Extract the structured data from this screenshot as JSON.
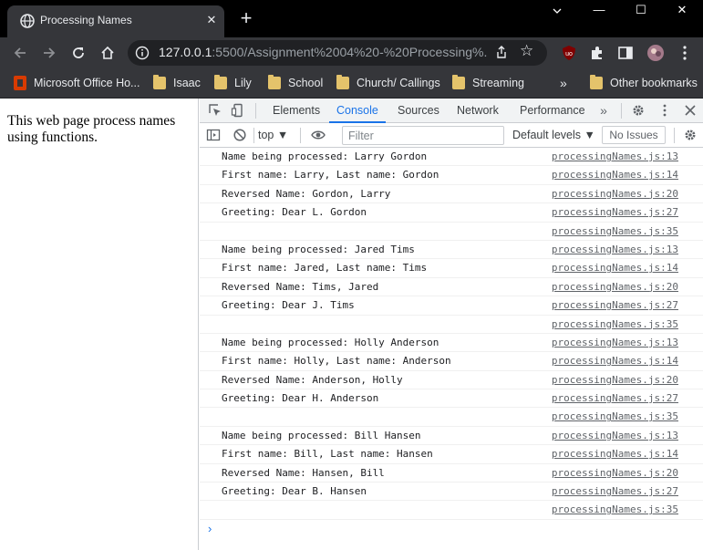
{
  "browser": {
    "tab_title": "Processing Names",
    "tab_close": "✕",
    "new_tab": "+",
    "window_controls": {
      "minimize": "—",
      "maximize": "☐",
      "close": "✕"
    },
    "url_host": "127.0.0.1",
    "url_rest": ":5500/Assignment%2004%20-%20Processing%...",
    "bookmarks": [
      {
        "label": "Microsoft Office Ho...",
        "icon": "office-icon"
      },
      {
        "label": "Isaac",
        "icon": "folder-icon"
      },
      {
        "label": "Lily",
        "icon": "folder-icon"
      },
      {
        "label": "School",
        "icon": "folder-icon"
      },
      {
        "label": "Church/ Callings",
        "icon": "folder-icon"
      },
      {
        "label": "Streaming",
        "icon": "folder-icon"
      }
    ],
    "bookmarks_overflow": "»",
    "other_bookmarks": "Other bookmarks"
  },
  "page": {
    "text": "This web page process names using functions."
  },
  "devtools": {
    "tabs": [
      "Elements",
      "Console",
      "Sources",
      "Network",
      "Performance"
    ],
    "active_tab": "Console",
    "more_tabs": "»",
    "context": "top ▼",
    "filter_placeholder": "Filter",
    "levels": "Default levels ▼",
    "issues": "No Issues",
    "console_rows": [
      {
        "msg": "Name being processed: Larry Gordon",
        "src": "processingNames.js:13"
      },
      {
        "msg": "First name: Larry, Last name: Gordon",
        "src": "processingNames.js:14"
      },
      {
        "msg": "Reversed Name: Gordon, Larry",
        "src": "processingNames.js:20"
      },
      {
        "msg": "Greeting: Dear L. Gordon",
        "src": "processingNames.js:27"
      },
      {
        "msg": "",
        "src": "processingNames.js:35"
      },
      {
        "msg": "Name being processed: Jared Tims",
        "src": "processingNames.js:13"
      },
      {
        "msg": "First name: Jared, Last name: Tims",
        "src": "processingNames.js:14"
      },
      {
        "msg": "Reversed Name: Tims, Jared",
        "src": "processingNames.js:20"
      },
      {
        "msg": "Greeting: Dear J. Tims",
        "src": "processingNames.js:27"
      },
      {
        "msg": "",
        "src": "processingNames.js:35"
      },
      {
        "msg": "Name being processed: Holly Anderson",
        "src": "processingNames.js:13"
      },
      {
        "msg": "First name: Holly, Last name: Anderson",
        "src": "processingNames.js:14"
      },
      {
        "msg": "Reversed Name: Anderson, Holly",
        "src": "processingNames.js:20"
      },
      {
        "msg": "Greeting: Dear H. Anderson",
        "src": "processingNames.js:27"
      },
      {
        "msg": "",
        "src": "processingNames.js:35"
      },
      {
        "msg": "Name being processed: Bill Hansen",
        "src": "processingNames.js:13"
      },
      {
        "msg": "First name: Bill, Last name: Hansen",
        "src": "processingNames.js:14"
      },
      {
        "msg": "Reversed Name: Hansen, Bill",
        "src": "processingNames.js:20"
      },
      {
        "msg": "Greeting: Dear B. Hansen",
        "src": "processingNames.js:27"
      },
      {
        "msg": "",
        "src": "processingNames.js:35"
      }
    ],
    "prompt": "›"
  },
  "colors": {
    "chrome_dark": "#35363a",
    "accent": "#1a73e8",
    "folder": "#e4c36b"
  }
}
